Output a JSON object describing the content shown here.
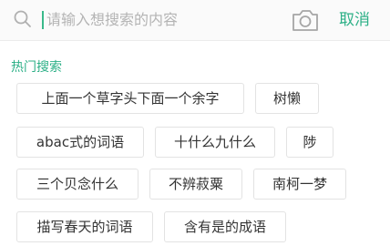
{
  "search": {
    "placeholder": "请输入想搜索的内容",
    "search_icon": "search-icon",
    "camera_icon": "camera-icon",
    "cancel_label": "取消"
  },
  "hot": {
    "title": "热门搜索",
    "rows": [
      [
        "上面一个草字头下面一个余字",
        "树懒"
      ],
      [
        "abac式的词语",
        "十什么九什么",
        "陟"
      ],
      [
        "三个贝念什么",
        "不辨菽粟",
        "南柯一梦"
      ],
      [
        "描写春天的词语",
        "含有是的成语"
      ]
    ]
  },
  "colors": {
    "accent": "#2db087",
    "chip_border": "#e3e3e3",
    "placeholder": "#b4b4b4"
  }
}
